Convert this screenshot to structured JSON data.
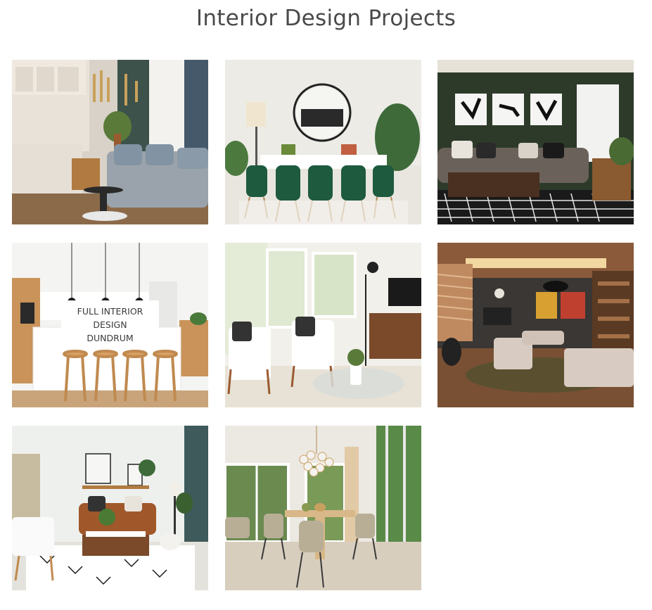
{
  "page": {
    "title": "Interior Design Projects"
  },
  "projects": [
    {
      "scene": "living-kitchen-gray-sofa"
    },
    {
      "scene": "dining-green-chairs"
    },
    {
      "scene": "living-green-wall-art"
    },
    {
      "scene": "kitchen-island-barstools",
      "overlay_lines": [
        "FULL INTERIOR",
        "DESIGN",
        "DUNDRUM"
      ]
    },
    {
      "scene": "bright-living-armchairs"
    },
    {
      "scene": "living-wood-ceiling"
    },
    {
      "scene": "living-leather-sofa"
    },
    {
      "scene": "dining-chandelier-windows"
    }
  ]
}
